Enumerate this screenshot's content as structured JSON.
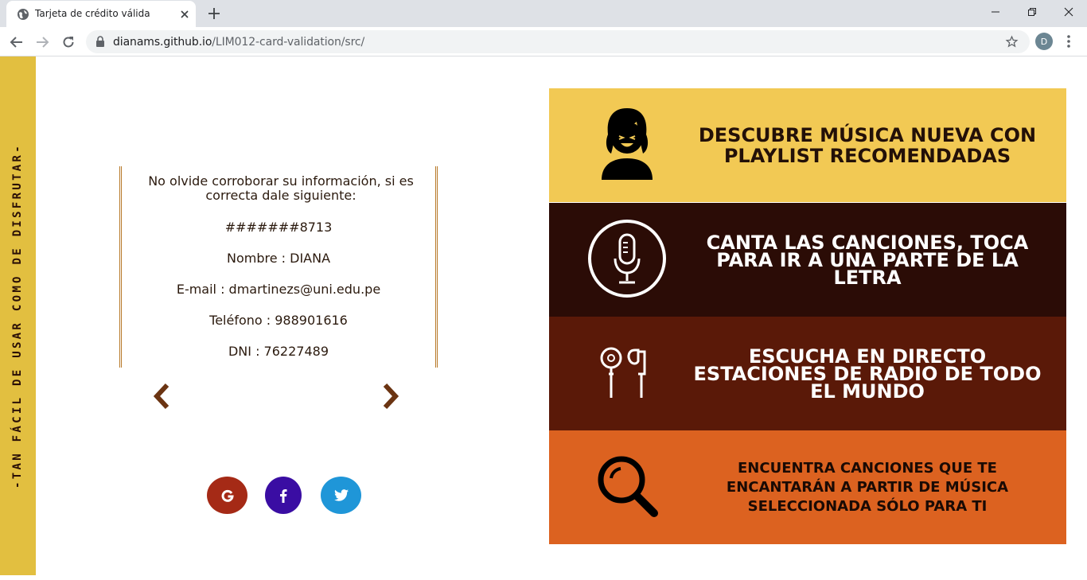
{
  "browser": {
    "tab_title": "Tarjeta de crédito válida",
    "url_host": "dianams.github.io",
    "url_path": "/LIM012-card-validation/src/",
    "profile_initial": "D"
  },
  "sidebar": {
    "tagline": "-TAN FÁCIL DE USAR COMO DE DISFRUTAR-"
  },
  "confirmation": {
    "message": "No olvide corroborar su información, si es correcta dale siguiente:",
    "card_number": "#######8713",
    "name": "Nombre : DIANA",
    "email": "E-mail : dmartinezs@uni.edu.pe",
    "phone": "Teléfono : 988901616",
    "dni": "DNI : 76227489"
  },
  "social": [
    {
      "icon": "google-icon",
      "label": "G",
      "color": "#a52a16"
    },
    {
      "icon": "facebook-icon",
      "label": "f",
      "color": "#3a0da3"
    },
    {
      "icon": "twitter-icon",
      "label": "twitter",
      "color": "#1f96d8"
    }
  ],
  "features": [
    {
      "text": "Descubre música nueva con playlist recomendadas",
      "bg": "#f2c954",
      "fg": "#231008",
      "icon": "person-laughing-icon"
    },
    {
      "text": "Canta las canciones, toca para ir a una parte de la letra",
      "bg": "#2b0c06",
      "fg": "#ffffff",
      "icon": "microphone-icon"
    },
    {
      "text": "Escucha en directo estaciones de radio de todo el mundo",
      "bg": "#5a1908",
      "fg": "#ffffff",
      "icon": "earphones-icon"
    },
    {
      "text": "Encuentra canciones que te encantarán a partir de música seleccionada sólo para ti",
      "bg": "#dc6220",
      "fg": "#1a0a04",
      "icon": "search-icon"
    }
  ],
  "colors": {
    "accent_yellow": "#e2bf40",
    "arrow_brown": "#6b3412",
    "border_gold": "#b87a2a"
  }
}
